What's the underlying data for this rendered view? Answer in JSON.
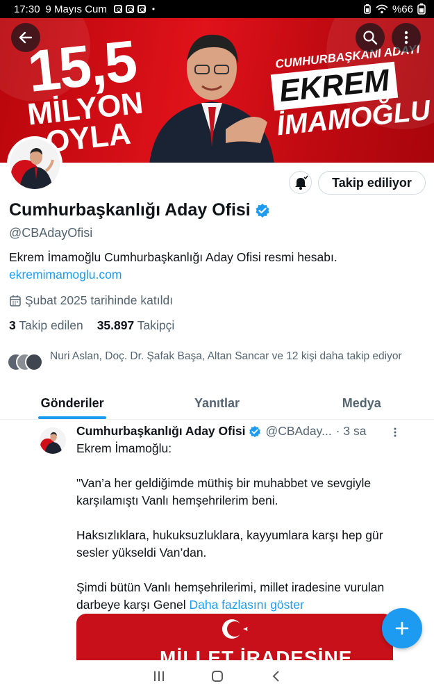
{
  "status_bar": {
    "time": "17:30",
    "date": "9 Mayıs Cum",
    "battery": "%66"
  },
  "banner": {
    "big_number": "15,5",
    "big_text": "MİLYON OYLA",
    "tag": "CUMHURBAŞKANI ADAYI",
    "first_name": "EKREM",
    "last_name": "İMAMOĞLU"
  },
  "profile": {
    "name": "Cumhurbaşkanlığı Aday Ofisi",
    "handle": "@CBAdayOfisi",
    "bio": "Ekrem İmamoğlu Cumhurbaşkanlığı Aday Ofisi resmi hesabı.",
    "link": "ekremimamoglu.com",
    "joined": "Şubat 2025 tarihinde katıldı",
    "following_count": "3",
    "following_label": "Takip edilen",
    "followers_count": "35.897",
    "followers_label": "Takipçi",
    "follow_button": "Takip ediliyor",
    "followed_by": "Nuri Aslan, Doç. Dr. Şafak Başa, Altan Sancar ve 12 kişi daha takip ediyor"
  },
  "tabs": [
    {
      "label": "Gönderiler",
      "active": true
    },
    {
      "label": "Yanıtlar",
      "active": false
    },
    {
      "label": "Medya",
      "active": false
    }
  ],
  "tweet": {
    "author": "Cumhurbaşkanlığı Aday Ofisi",
    "handle": "@CBAday...",
    "time": "· 3 sa",
    "line1": "Ekrem İmamoğlu:",
    "para1": "\"Van’a her geldiğimde müthiş bir muhabbet ve sevgiyle karşılamıştı Vanlı hemşehrilerim beni.",
    "para2": "Haksızlıklara, hukuksuzluklara, kayyumlara karşı hep gür sesler yükseldi Van’dan.",
    "para3": "Şimdi bütün Vanlı hemşehrilerimi, millet iradesine vurulan darbeye karşı Genel",
    "show_more": "Daha fazlasını göster",
    "image_text": "MİLLET İRADESİNE"
  },
  "colors": {
    "accent": "#1d9bf0",
    "banner_red": "#d4111a",
    "text_secondary": "#536471"
  },
  "icons": [
    "back-arrow-icon",
    "search-icon",
    "more-vertical-icon",
    "bell-icon",
    "verified-badge-icon",
    "calendar-icon",
    "plus-icon",
    "recent-apps-icon",
    "home-icon",
    "back-icon"
  ]
}
